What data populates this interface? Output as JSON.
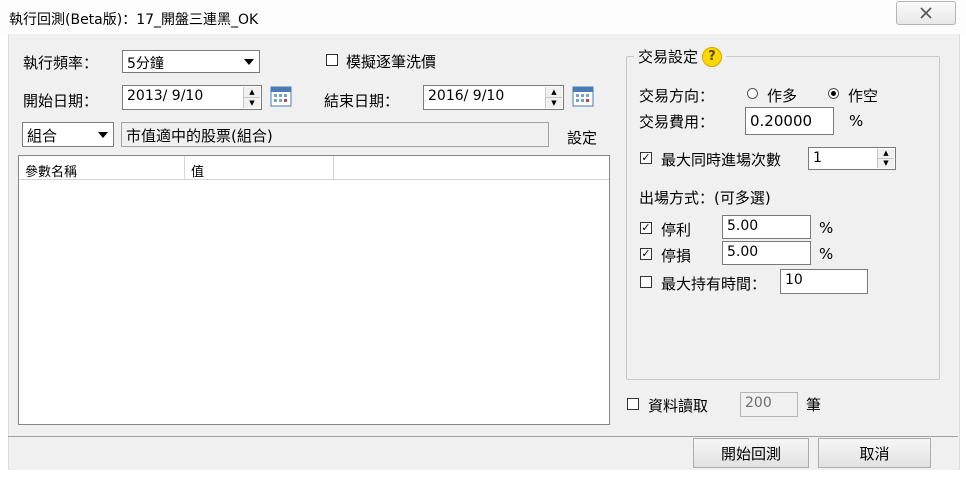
{
  "window": {
    "title": "執行回測(Beta版)：17_開盤三連黑_OK"
  },
  "left": {
    "frequency_label": "執行頻率：",
    "frequency_value": "5分鐘",
    "simulate_label": "模擬逐筆洗價",
    "simulate_checked": false,
    "start_label": "開始日期：",
    "start_value": "2013/  9/10",
    "end_label": "結束日期：",
    "end_value": "2016/  9/10",
    "combo_type": "組合",
    "combo_text": "市值適中的股票(組合)",
    "settings_label": "設定",
    "params_headers": [
      "參數名稱",
      "值"
    ]
  },
  "trade": {
    "group_title": "交易設定",
    "help": "?",
    "direction_label": "交易方向：",
    "long_label": "作多",
    "short_label": "作空",
    "selected_direction": "short",
    "fee_label": "交易費用：",
    "fee_value": "0.20000",
    "percent": "%",
    "max_entries_label": "最大同時進場次數",
    "max_entries_checked": true,
    "max_entries_value": "1",
    "exit_label": "出場方式：(可多選)",
    "take_profit_label": "停利",
    "take_profit_checked": true,
    "take_profit_value": "5.00",
    "stop_loss_label": "停損",
    "stop_loss_checked": true,
    "stop_loss_value": "5.00",
    "max_hold_label": "最大持有時間：",
    "max_hold_checked": false,
    "max_hold_value": "10"
  },
  "data_read": {
    "label": "資料讀取",
    "checked": false,
    "value": "200",
    "unit": "筆"
  },
  "buttons": {
    "start": "開始回測",
    "cancel": "取消"
  }
}
